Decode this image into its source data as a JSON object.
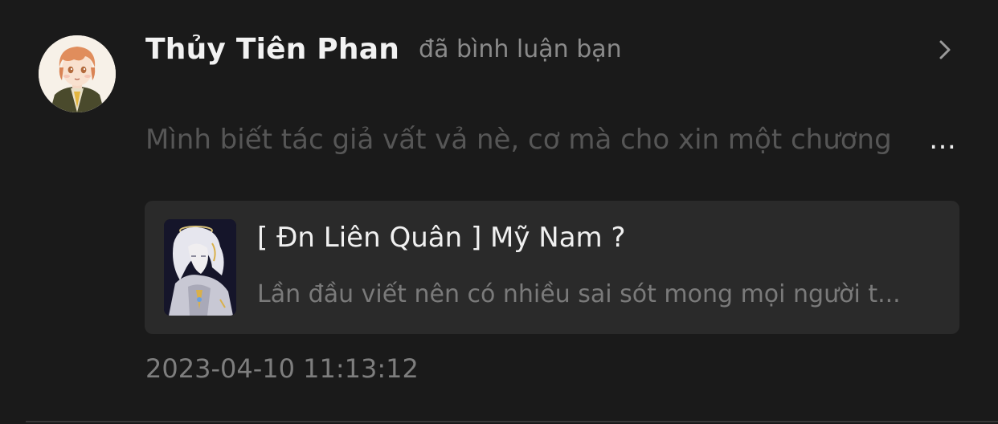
{
  "notification": {
    "user_name": "Thủy Tiên Phan",
    "action": "đã bình luận bạn",
    "comment": "Mình biết tác giả vất vả nè, cơ mà cho xin một chương",
    "comment_ellipsis": "…",
    "timestamp": "2023-04-10 11:13:12",
    "chevron_icon": "chevron-right-icon",
    "avatar_icon": "user-avatar"
  },
  "story": {
    "title": "[ Đn Liên Quân ] Mỹ Nam ?",
    "description": "Lần đầu viết nên có nhiều sai sót mong mọi người t...",
    "cover_icon": "story-cover-image"
  },
  "colors": {
    "background": "#1a1a1a",
    "card": "#2a2a2a",
    "name": "#f2f2f2",
    "secondary": "#8a8a8a",
    "comment": "#565656",
    "divider": "#383838"
  }
}
